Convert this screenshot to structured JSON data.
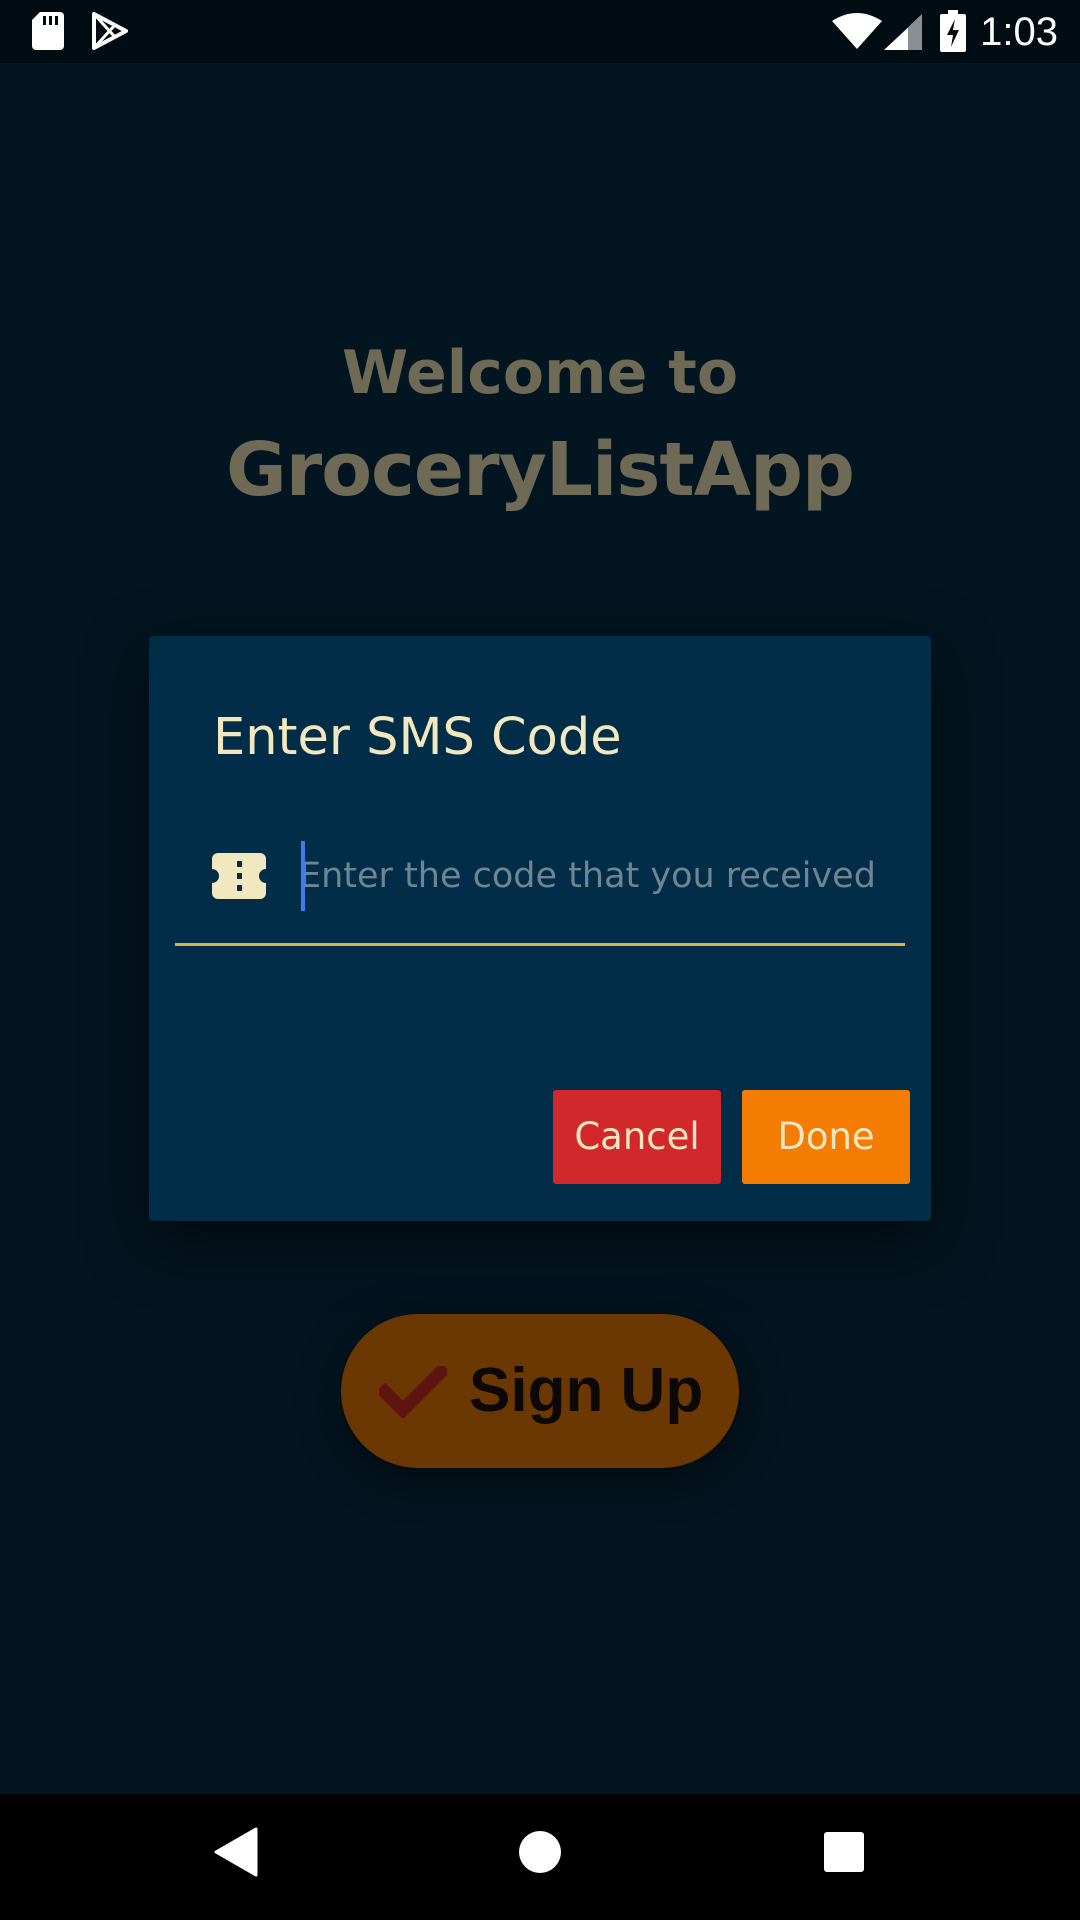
{
  "status_bar": {
    "time": "1:03",
    "left_icons": [
      "sd-card-icon",
      "play-store-icon"
    ],
    "right_icons": [
      "wifi-icon",
      "cell-signal-icon",
      "battery-charging-icon"
    ]
  },
  "welcome": {
    "line1": "Welcome to",
    "line2": "GroceryListApp"
  },
  "signup": {
    "icon": "check-icon",
    "label": "Sign Up"
  },
  "dialog": {
    "title": "Enter SMS Code",
    "input_icon": "ticket-icon",
    "input_value": "",
    "input_placeholder": "Enter the code that you received",
    "cancel_label": "Cancel",
    "done_label": "Done"
  },
  "nav_bar": {
    "icons": [
      "back-icon",
      "home-icon",
      "recents-icon"
    ]
  },
  "colors": {
    "background": "#031520",
    "dialog": "#012d48",
    "accent_text": "#f1e8bf",
    "underline": "#dcb34a",
    "cancel": "#d2272b",
    "done": "#f47c00",
    "signup": "#6b3703",
    "welcome_text": "#6e6a55"
  }
}
